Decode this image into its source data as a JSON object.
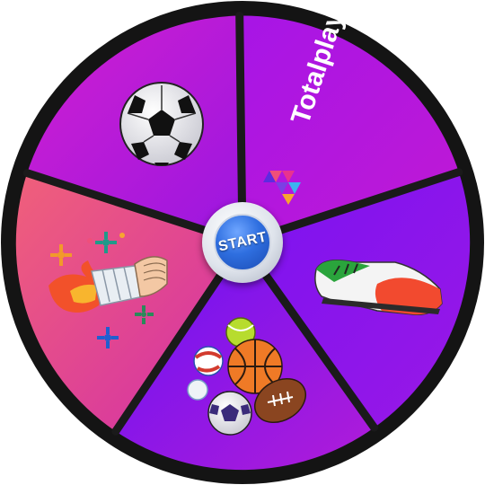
{
  "start_button": {
    "label": "START"
  },
  "brand": {
    "name": "Totalplay",
    "mark": "®"
  },
  "segments": [
    {
      "name": "soccer-ball"
    },
    {
      "name": "totalplay-logo"
    },
    {
      "name": "soccer-cleat"
    },
    {
      "name": "sports-balls"
    },
    {
      "name": "torch-fire"
    }
  ],
  "colors": {
    "rim": "#141414",
    "segment_magenta": "#cc1fcf",
    "segment_purple": "#9a14e6",
    "segment_violet": "#7a12f0",
    "segment_blue_violet": "#6b14f2",
    "segment_pink": "#ef4f8a",
    "start_blue": "#2f6fe0"
  }
}
